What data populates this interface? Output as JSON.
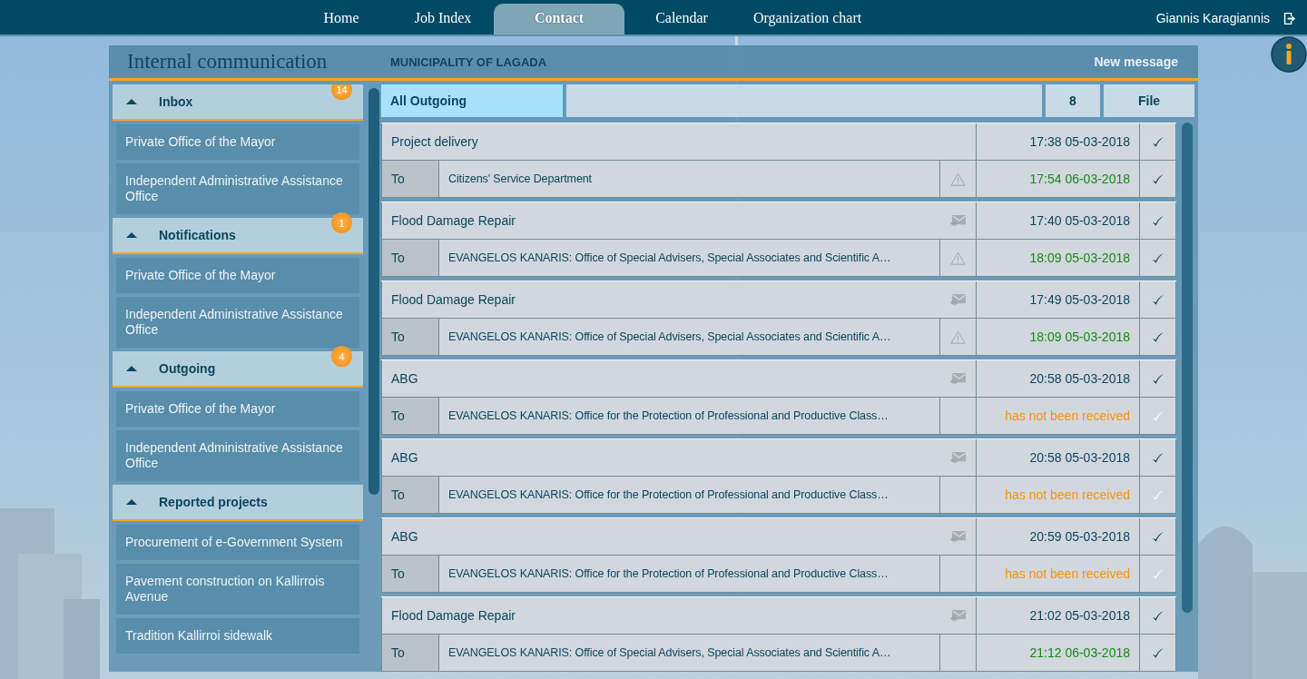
{
  "nav": {
    "tabs": [
      {
        "label": "Home",
        "selected": false
      },
      {
        "label": "Job Index",
        "selected": false
      },
      {
        "label": "Contact",
        "selected": true
      },
      {
        "label": "Calendar",
        "selected": false
      },
      {
        "label": "Organization chart",
        "selected": false
      }
    ],
    "user": "Giannis Karagiannis"
  },
  "header": {
    "title": "Internal communication",
    "organization": "MUNICIPALITY OF LAGADA",
    "new_message": "New message"
  },
  "sidebar": {
    "sections": [
      {
        "title": "Inbox",
        "expanded": true,
        "badge": "14",
        "items": [
          {
            "label": "Private Office of the Mayor"
          },
          {
            "label": "Independent Administrative Assistance Office"
          }
        ]
      },
      {
        "title": "Notifications",
        "expanded": true,
        "badge": "1",
        "items": [
          {
            "label": "Private Office of the Mayor"
          },
          {
            "label": "Independent Administrative Assistance Office"
          }
        ]
      },
      {
        "title": "Outgoing",
        "expanded": true,
        "badge": "4",
        "items": [
          {
            "label": "Private Office of the Mayor"
          },
          {
            "label": "Independent Administrative Assistance Office"
          }
        ]
      },
      {
        "title": "Reported projects",
        "expanded": true,
        "items": [
          {
            "label": "Procurement of e-Government System"
          },
          {
            "label": "Pavement construction on Kallirrois Avenue"
          },
          {
            "label": "Tradition Kallirroi sidewalk"
          }
        ]
      }
    ]
  },
  "toolbar": {
    "filter": "All Outgoing",
    "count": "8",
    "file": "File"
  },
  "messages": [
    {
      "subject": "Project delivery",
      "reply": false,
      "sent": "17:38 05-03-2018",
      "to_label": "To",
      "recipient": "Citizens' Service Department",
      "warning": true,
      "receipt": "17:54 06-03-2018",
      "received": true
    },
    {
      "subject": "Flood Damage Repair",
      "reply": true,
      "sent": "17:40 05-03-2018",
      "to_label": "To",
      "recipient": "EVANGELOS KANARIS: Office of Special Advisers, Special Associates and Scientific A…",
      "warning": true,
      "receipt": "18:09 05-03-2018",
      "received": true
    },
    {
      "subject": "Flood Damage Repair",
      "reply": true,
      "sent": "17:49 05-03-2018",
      "to_label": "To",
      "recipient": "EVANGELOS KANARIS: Office of Special Advisers, Special Associates and Scientific A…",
      "warning": true,
      "receipt": "18:09 05-03-2018",
      "received": true
    },
    {
      "subject": "ABG",
      "reply": true,
      "sent": "20:58 05-03-2018",
      "to_label": "To",
      "recipient": "EVANGELOS KANARIS: Office for the Protection of Professional and Productive Class…",
      "warning": false,
      "receipt": "has not been received",
      "received": false
    },
    {
      "subject": "ABG",
      "reply": true,
      "sent": "20:58 05-03-2018",
      "to_label": "To",
      "recipient": "EVANGELOS KANARIS: Office for the Protection of Professional and Productive Class…",
      "warning": false,
      "receipt": "has not been received",
      "received": false
    },
    {
      "subject": "ABG",
      "reply": true,
      "sent": "20:59 05-03-2018",
      "to_label": "To",
      "recipient": "EVANGELOS KANARIS: Office for the Protection of Professional and Productive Class…",
      "warning": false,
      "receipt": "has not been received",
      "received": false
    },
    {
      "subject": "Flood Damage Repair",
      "reply": true,
      "sent": "21:02 05-03-2018",
      "to_label": "To",
      "recipient": "EVANGELOS KANARIS: Office of Special Advisers, Special Associates and Scientific A…",
      "warning": false,
      "receipt": "21:12 06-03-2018",
      "received": true
    }
  ]
}
